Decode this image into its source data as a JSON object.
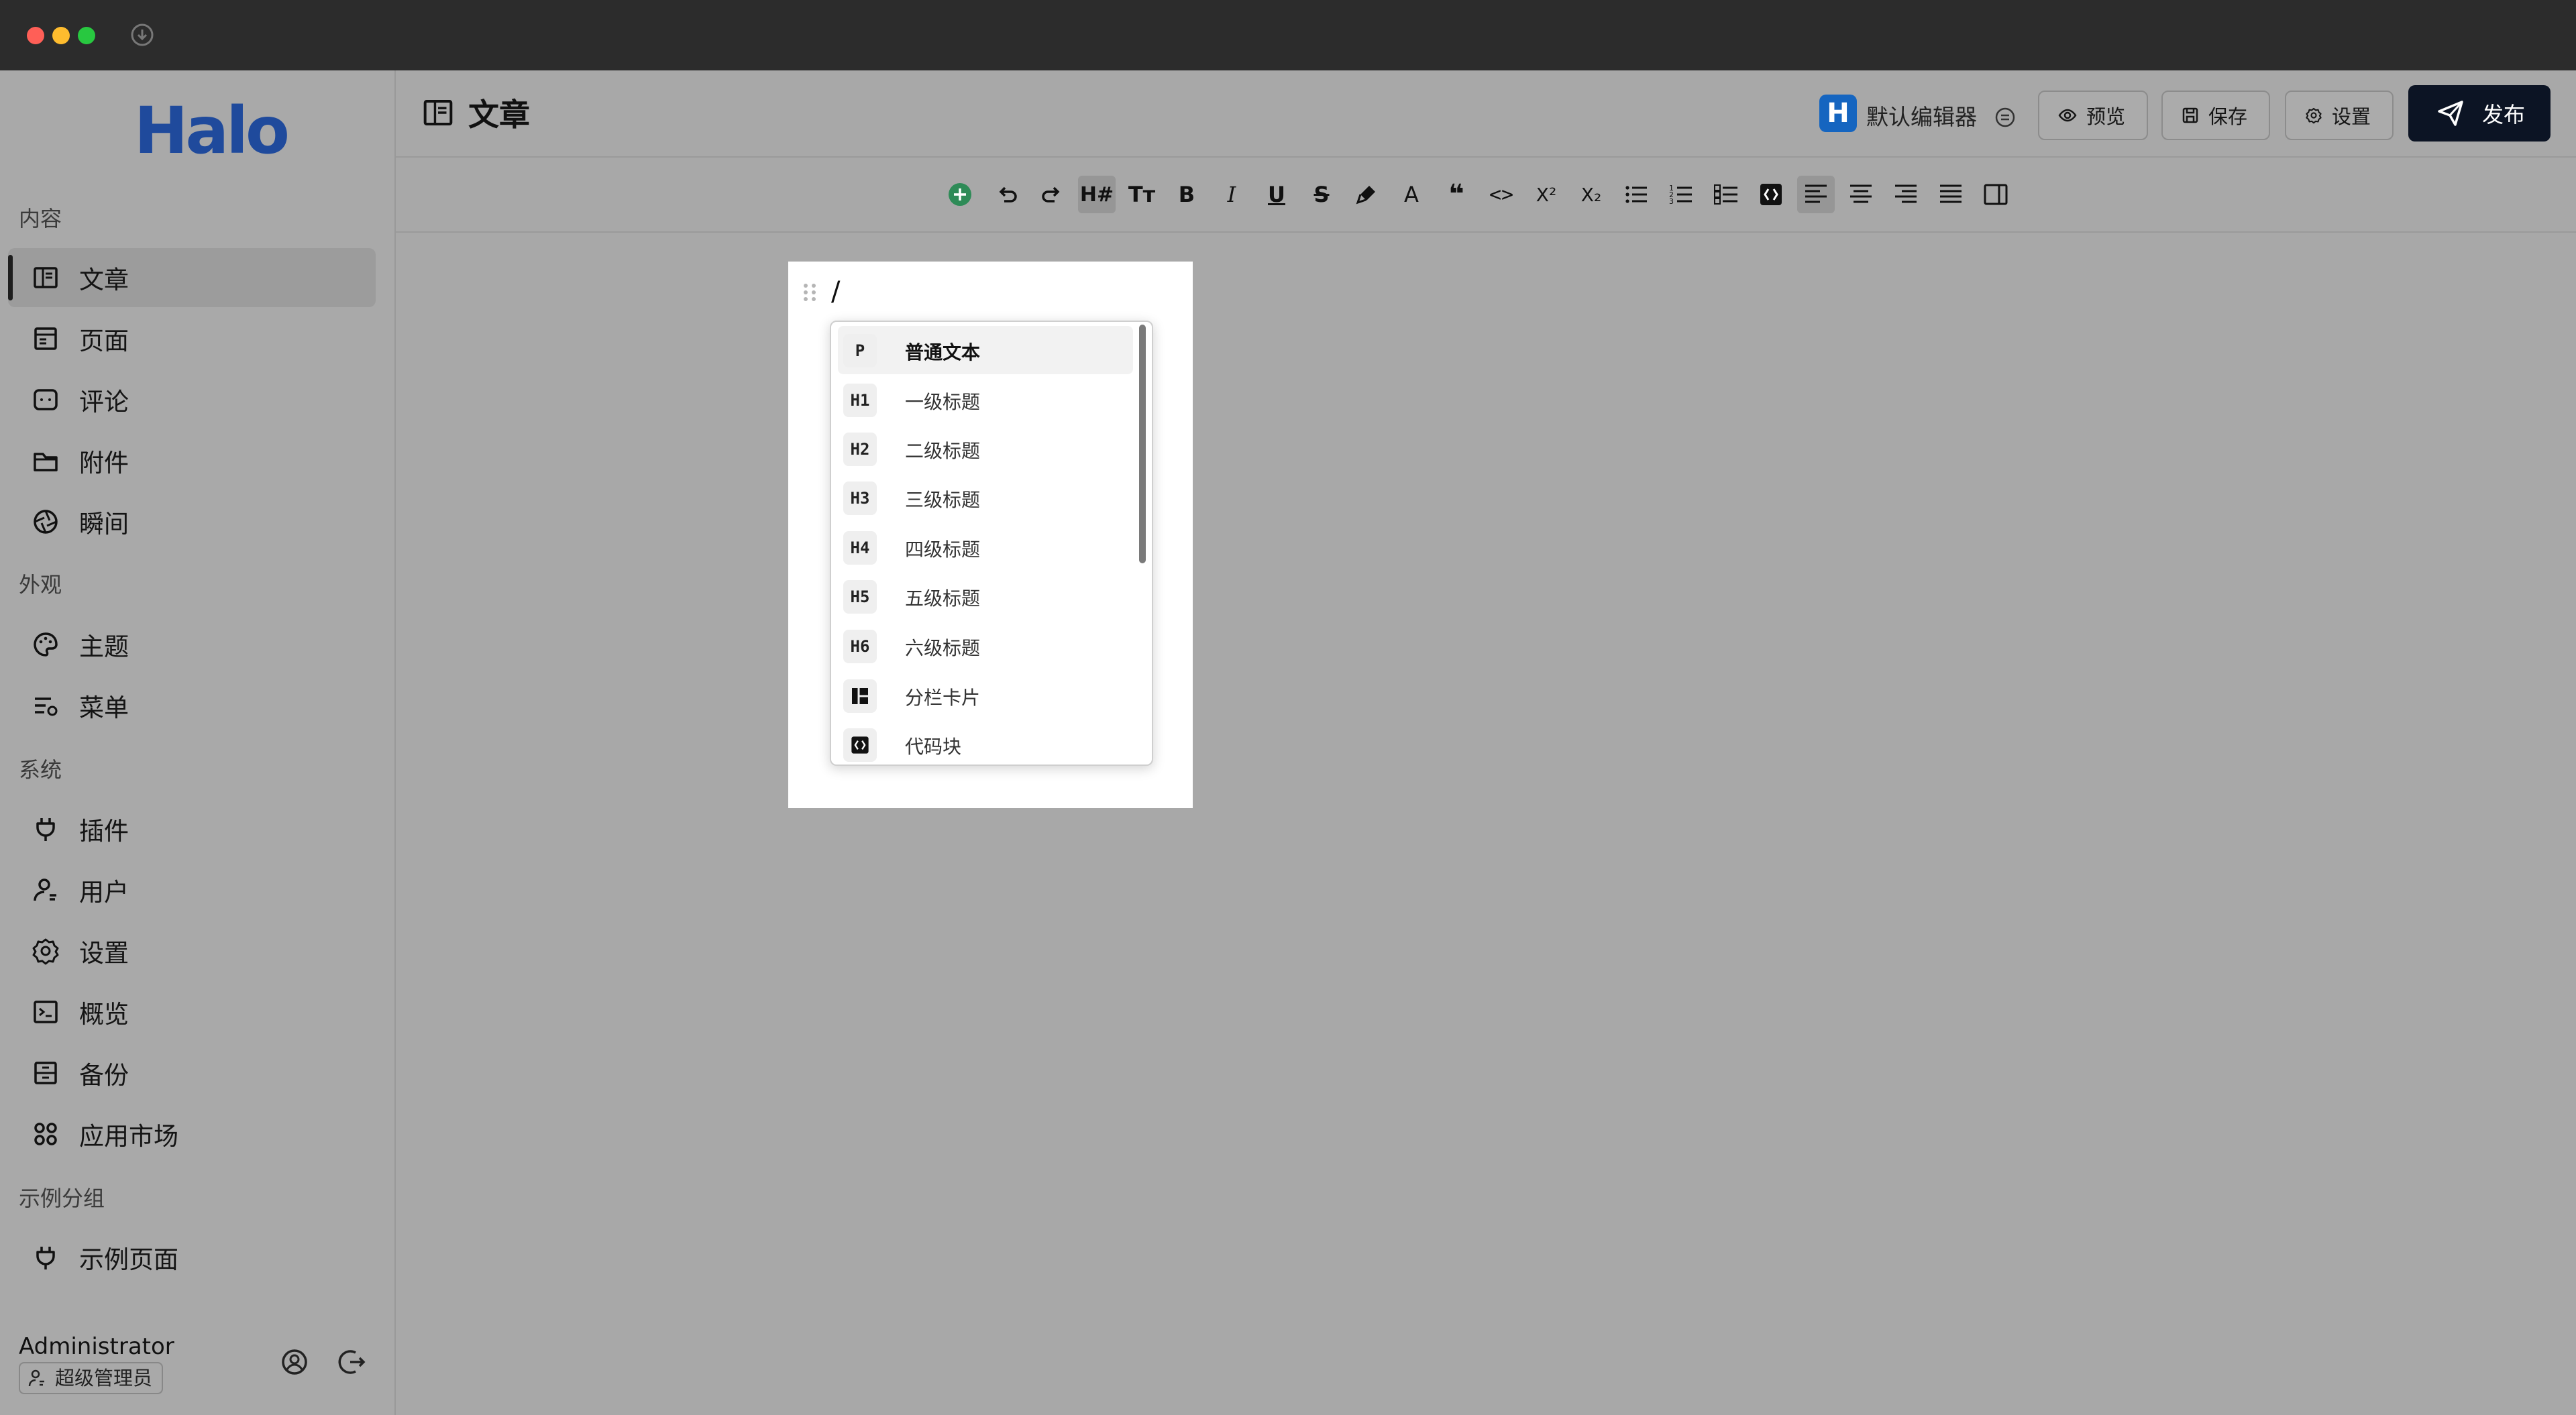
{
  "app": {
    "logo": "Halo"
  },
  "sidebar": {
    "groups": [
      {
        "label": "内容"
      },
      {
        "label": "外观"
      },
      {
        "label": "系统"
      },
      {
        "label": "示例分组"
      }
    ],
    "items": [
      {
        "label": "文章"
      },
      {
        "label": "页面"
      },
      {
        "label": "评论"
      },
      {
        "label": "附件"
      },
      {
        "label": "瞬间"
      },
      {
        "label": "主题"
      },
      {
        "label": "菜单"
      },
      {
        "label": "插件"
      },
      {
        "label": "用户"
      },
      {
        "label": "设置"
      },
      {
        "label": "概览"
      },
      {
        "label": "备份"
      },
      {
        "label": "应用市场"
      },
      {
        "label": "示例页面"
      }
    ],
    "user": {
      "name": "Administrator",
      "role": "超级管理员"
    }
  },
  "header": {
    "title": "文章",
    "editor_badge": "H",
    "editor_label": "默认编辑器",
    "preview_label": "预览",
    "save_label": "保存",
    "settings_label": "设置",
    "publish_label": "发布"
  },
  "toolbar": {
    "heading_label": "H#",
    "font_size_label": "Tт",
    "bold_label": "B",
    "italic_label": "I",
    "underline_label": "U",
    "strike_label": "S",
    "color_label": "A",
    "quote_label": "❝",
    "code_label": "<>",
    "sup_label": "X²",
    "sub_label": "X₂"
  },
  "editor": {
    "content": "/"
  },
  "slash_menu": {
    "items": [
      {
        "icon": "P",
        "label": "普通文本"
      },
      {
        "icon": "H1",
        "label": "一级标题"
      },
      {
        "icon": "H2",
        "label": "二级标题"
      },
      {
        "icon": "H3",
        "label": "三级标题"
      },
      {
        "icon": "H4",
        "label": "四级标题"
      },
      {
        "icon": "H5",
        "label": "五级标题"
      },
      {
        "icon": "H6",
        "label": "六级标题"
      },
      {
        "icon": "columns-icon",
        "label": "分栏卡片"
      },
      {
        "icon": "code-block-icon",
        "label": "代码块"
      }
    ]
  },
  "colors": {
    "accent": "#1565c0",
    "publish_bg": "#0c1424",
    "logo": "#1f4a9c",
    "add_button": "#2e8b57"
  }
}
